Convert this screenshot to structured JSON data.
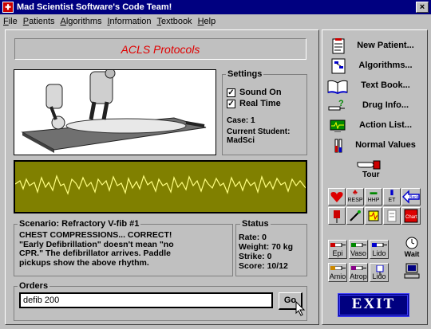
{
  "window": {
    "title": "Mad Scientist Software's Code Team!",
    "close": "×"
  },
  "menu": [
    "File",
    "Patients",
    "Algorithms",
    "Information",
    "Textbook",
    "Help"
  ],
  "header": {
    "title": "ACLS Protocols"
  },
  "settings": {
    "label": "Settings",
    "sound_on": "Sound On",
    "real_time": "Real Time",
    "case": "Case:  1",
    "current_student_label": "Current Student:",
    "current_student": "MadSci"
  },
  "scenario": {
    "label": "Scenario: Refractory V-fib #1",
    "text_1": "CHEST COMPRESSIONS... CORRECT!",
    "text_2": "\"Early Defibrillation\" doesn't mean \"no",
    "text_3": "CPR.\" The defibrillator arrives. Paddle",
    "text_4": "pickups show the above rhythm."
  },
  "status": {
    "label": "Status",
    "rate": "Rate:   0",
    "weight": "Weight:  70 kg",
    "strike": "Strike:  0",
    "score": "Score: 10/12"
  },
  "orders": {
    "label": "Orders",
    "value": "defib 200",
    "go": "Go"
  },
  "right_menu": {
    "new_patient": "New Patient...",
    "algorithms": "Algorithms...",
    "text_book": "Text Book...",
    "drug_info": "Drug Info...",
    "action_list": "Action List...",
    "normal_values": "Normal Values",
    "tour": "Tour"
  },
  "tool_buttons": {
    "resp": "RESP",
    "hhp": "HHP",
    "et": "ET",
    "back": "Back",
    "chart": "Chart"
  },
  "drugs": {
    "epi": "Epi",
    "vaso": "Vaso",
    "lido": "Lido",
    "wait": "Wait",
    "amio": "Amio",
    "atrop": "Atrop",
    "lido2": "Lido"
  },
  "exit": "EXIT",
  "colors": {
    "monitor": "#808000",
    "waveform": "#ffff80",
    "title_bar": "#000080",
    "header_text": "#e00000"
  }
}
